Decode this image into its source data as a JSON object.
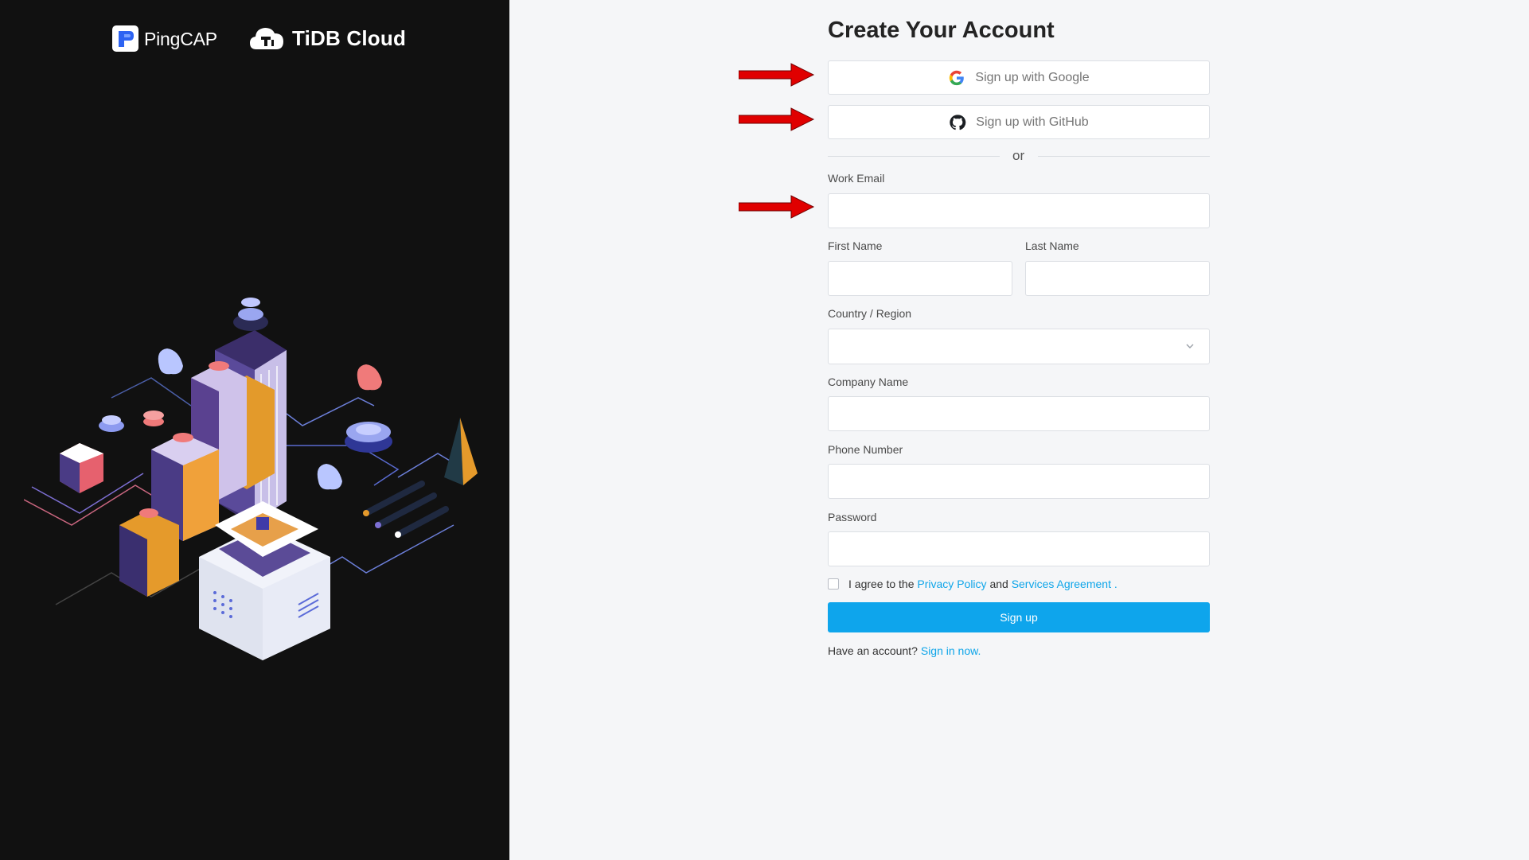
{
  "brand": {
    "company": "PingCAP",
    "product": "TiDB Cloud"
  },
  "form": {
    "title": "Create Your Account",
    "google_button": "Sign up with Google",
    "github_button": "Sign up with GitHub",
    "divider_text": "or",
    "work_email_label": "Work Email",
    "work_email_value": "",
    "first_name_label": "First Name",
    "first_name_value": "",
    "last_name_label": "Last Name",
    "last_name_value": "",
    "country_label": "Country / Region",
    "country_value": "",
    "company_label": "Company Name",
    "company_value": "",
    "phone_label": "Phone Number",
    "phone_value": "",
    "password_label": "Password",
    "password_value": "",
    "agree_prefix": "I agree to the",
    "privacy_link": "Privacy Policy",
    "agree_and": "and",
    "services_link": "Services Agreement",
    "agree_suffix": ".",
    "signup_button": "Sign up",
    "have_account": "Have an account?",
    "signin_link": "Sign in now."
  },
  "colors": {
    "left_panel_bg": "#111111",
    "right_panel_bg": "#f5f6f8",
    "primary": "#0ea5ec",
    "link": "#0ea5e9",
    "annotation_arrow": "#e00000"
  },
  "icons": [
    "pingcap-logo-icon",
    "tidb-cloud-logo-icon",
    "google-icon",
    "github-icon",
    "chevron-down-icon",
    "annotation-arrow-icon"
  ]
}
